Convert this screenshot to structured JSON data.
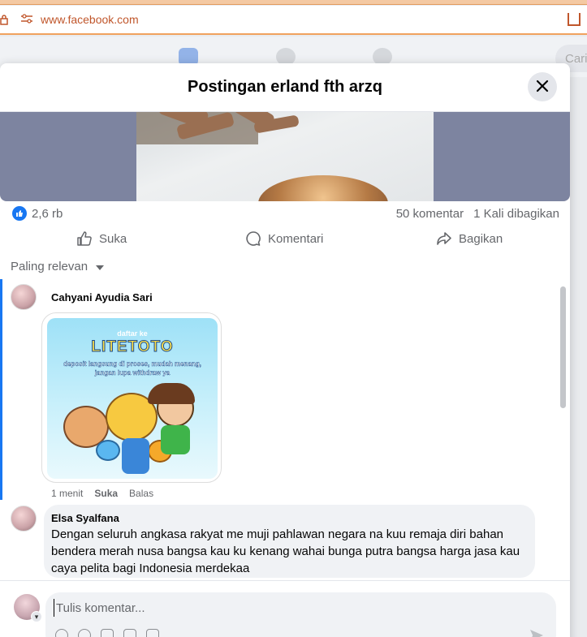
{
  "browser": {
    "url": "www.facebook.com"
  },
  "fb_header": {
    "search_placeholder": "Cari"
  },
  "modal": {
    "title": "Postingan erland fth arzq",
    "close_icon": "close-icon"
  },
  "post": {
    "reaction_count": "2,6 rb",
    "comment_count": "50 komentar",
    "share_count": "1 Kali dibagikan",
    "actions": {
      "like": "Suka",
      "comment": "Komentari",
      "share": "Bagikan"
    }
  },
  "comments": {
    "sort_label": "Paling relevan",
    "items": [
      {
        "author": "Cahyani Ayudia Sari",
        "sticker": {
          "line1": "daftar ke",
          "logo": "LITETOTO",
          "line2": "deposit langsung di proses, mudah menang,",
          "line3": "jangan lupa withdraw ya"
        },
        "time": "1 menit",
        "like": "Suka",
        "reply": "Balas"
      },
      {
        "author": "Elsa Syalfana",
        "text": "Dengan seluruh angkasa rakyat me muji pahlawan negara na kuu remaja diri bahan bendera merah nusa bangsa kau ku kenang wahai bunga putra bangsa harga jasa kau caya pelita bagi Indonesia merdekaa"
      }
    ]
  },
  "composer": {
    "placeholder": "Tulis komentar..."
  },
  "colors": {
    "accent": "#1877f2",
    "secondary_text": "#65676b",
    "bubble_bg": "#f0f2f5"
  }
}
